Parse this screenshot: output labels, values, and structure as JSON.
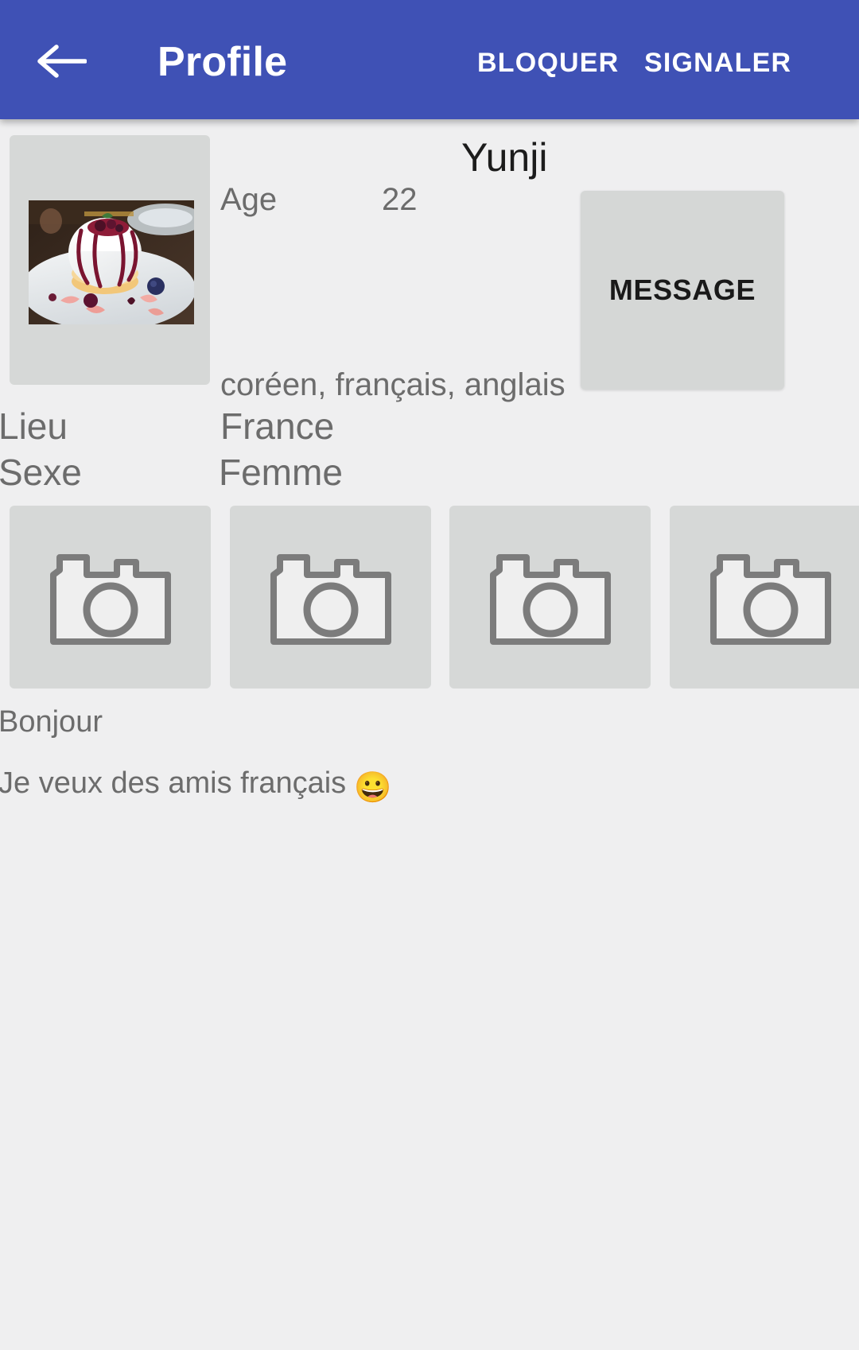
{
  "colors": {
    "appbar": "#3f51b5",
    "page_background": "#efeff0",
    "card_gray": "#d6d8d7",
    "text_primary": "#1c1c1c",
    "text_secondary": "#6c6c6c",
    "appbar_text": "#ffffff"
  },
  "appbar": {
    "back_icon": "arrow-left-icon",
    "title": "Profile",
    "actions": [
      {
        "label": "BLOQUER",
        "name": "block-action"
      },
      {
        "label": "SIGNALER",
        "name": "report-action"
      }
    ]
  },
  "profile": {
    "name": "Yunji",
    "avatar_icon": "dessert-photo",
    "message_button": "MESSAGE",
    "fields": [
      {
        "label": "Age",
        "value": "22"
      },
      {
        "label": "",
        "value": "coréen, français, anglais"
      },
      {
        "label": "Lieu",
        "value": "France"
      },
      {
        "label": "Sexe",
        "value": "Femme"
      }
    ]
  },
  "photos": {
    "placeholder_icon": "camera-icon",
    "items": [
      {
        "alt": "photo-placeholder-1"
      },
      {
        "alt": "photo-placeholder-2"
      },
      {
        "alt": "photo-placeholder-3"
      },
      {
        "alt": "photo-placeholder-4"
      }
    ]
  },
  "bio": {
    "line1": "Bonjour",
    "line2": "Je veux des amis français",
    "emoji": "😀"
  }
}
